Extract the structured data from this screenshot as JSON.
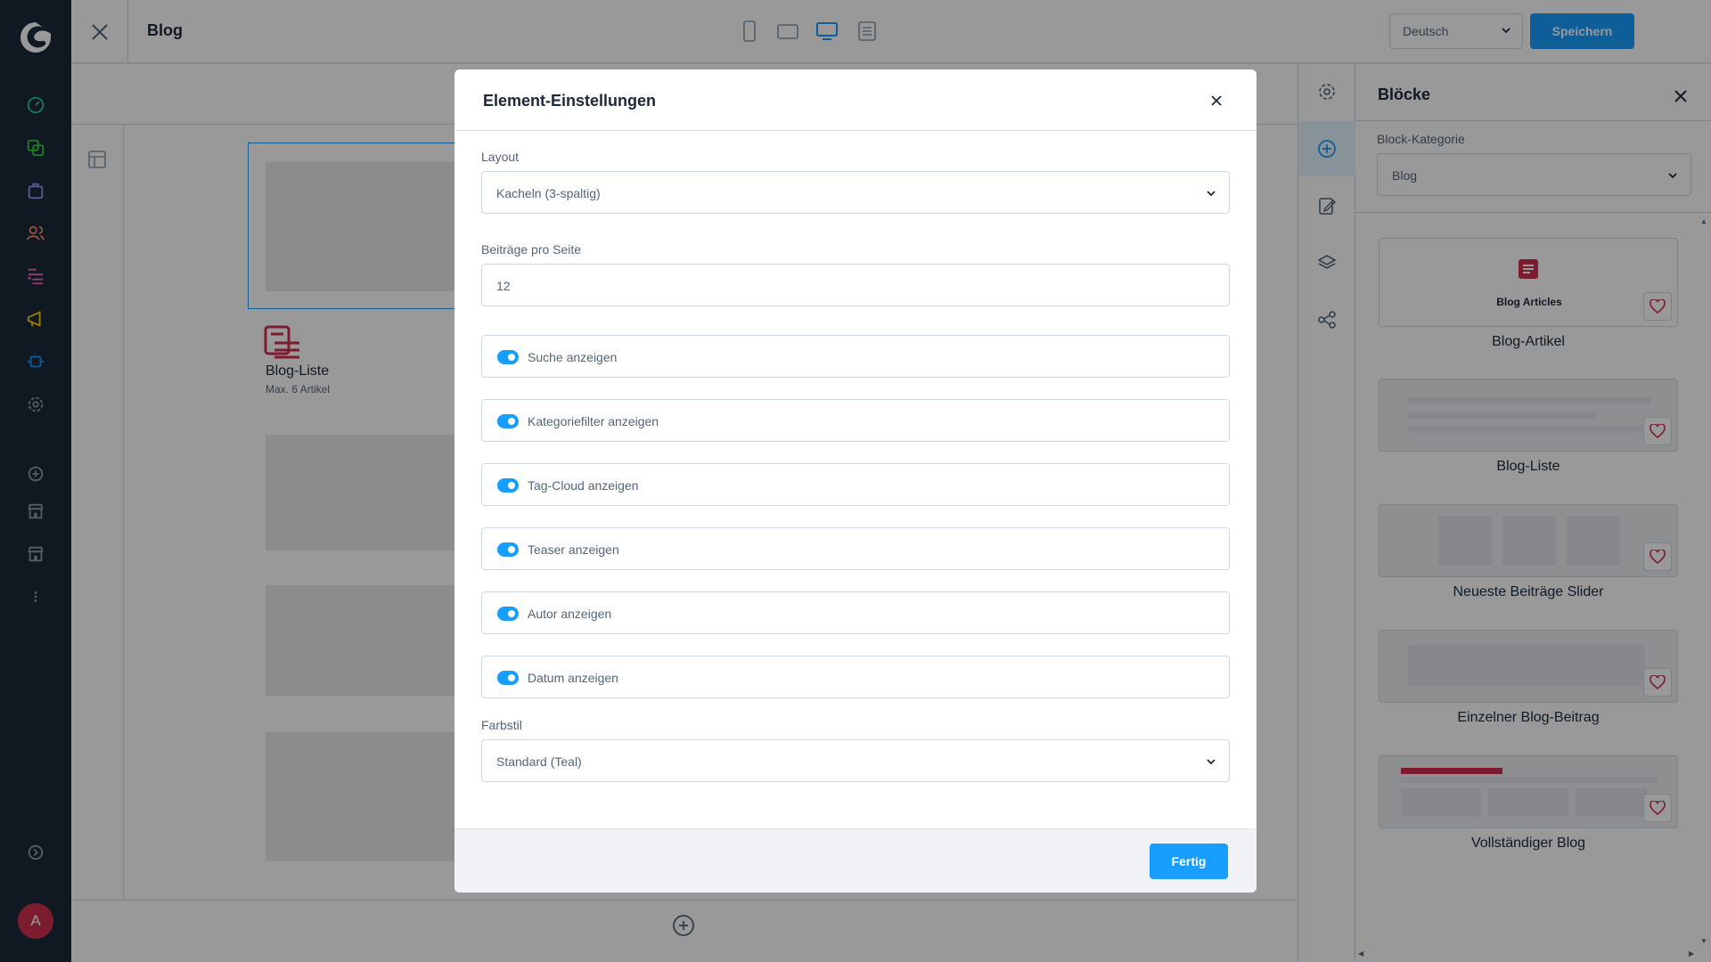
{
  "header": {
    "title": "Blog",
    "language": "Deutsch",
    "save_label": "Speichern"
  },
  "canvas": {
    "block_title": "Blog-Liste",
    "block_subtitle": "Max. 6 Artikel"
  },
  "blocks_panel": {
    "title": "Blöcke",
    "category_label": "Block-Kategorie",
    "category_value": "Blog",
    "items": [
      {
        "name": "Blog-Artikel",
        "preview_label": "Blog Articles"
      },
      {
        "name": "Blog-Liste"
      },
      {
        "name": "Neueste Beiträge Slider"
      },
      {
        "name": "Einzelner Blog-Beitrag"
      },
      {
        "name": "Vollständiger Blog"
      }
    ]
  },
  "modal": {
    "title": "Element-Einstellungen",
    "layout_label": "Layout",
    "layout_value": "Kacheln (3-spaltig)",
    "per_page_label": "Beiträge pro Seite",
    "per_page_value": "12",
    "switches": [
      {
        "label": "Suche anzeigen",
        "on": true
      },
      {
        "label": "Kategoriefilter anzeigen",
        "on": true
      },
      {
        "label": "Tag-Cloud anzeigen",
        "on": true
      },
      {
        "label": "Teaser anzeigen",
        "on": true
      },
      {
        "label": "Autor anzeigen",
        "on": true
      },
      {
        "label": "Datum anzeigen",
        "on": true
      }
    ],
    "color_label": "Farbstil",
    "color_value": "Standard (Teal)",
    "done_label": "Fertig"
  },
  "user": {
    "avatar_initial": "A"
  },
  "colors": {
    "accent": "#189eff",
    "nav_bg": "#1b2a3a",
    "brand_red": "#d0304d"
  }
}
